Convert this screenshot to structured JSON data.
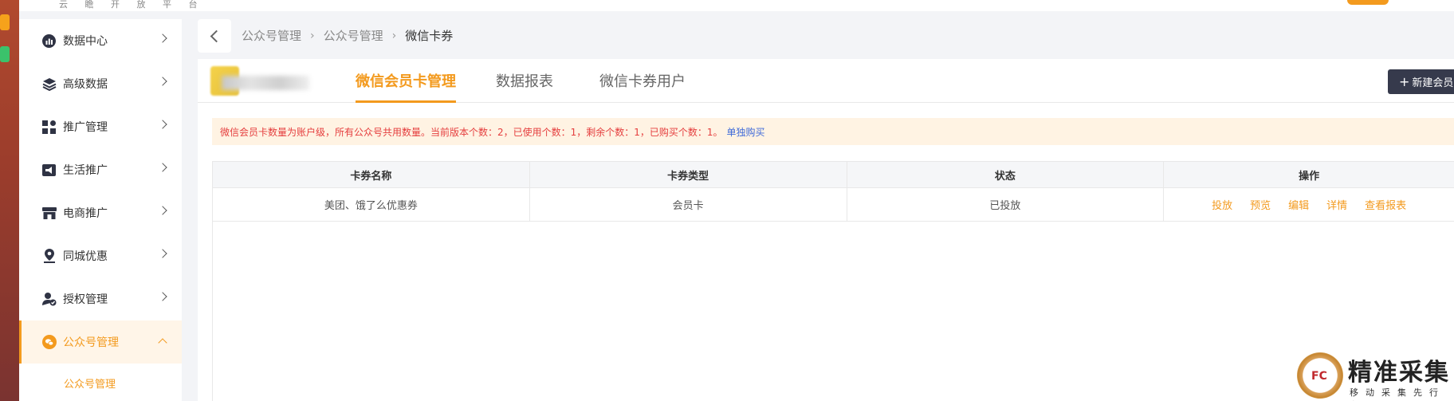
{
  "brand": {
    "subtitle": "云 瞻 开 放 平 台"
  },
  "colors": {
    "accent": "#f39a1e",
    "notice_text": "#e53e3e",
    "link": "#3f6ad8",
    "dark_button": "#363a4c"
  },
  "sidebar": {
    "items": [
      {
        "label": "数据中心",
        "icon": "chart-icon"
      },
      {
        "label": "高级数据",
        "icon": "layers-icon"
      },
      {
        "label": "推广管理",
        "icon": "grid-icon"
      },
      {
        "label": "生活推广",
        "icon": "megaphone-icon"
      },
      {
        "label": "电商推广",
        "icon": "shop-icon"
      },
      {
        "label": "同城优惠",
        "icon": "location-icon"
      },
      {
        "label": "授权管理",
        "icon": "user-check-icon"
      },
      {
        "label": "公众号管理",
        "icon": "wechat-icon",
        "active": true
      }
    ],
    "subitem": "公众号管理"
  },
  "breadcrumb": [
    "公众号管理",
    "公众号管理",
    "微信卡券"
  ],
  "tabs": [
    {
      "label": "微信会员卡管理",
      "active": true
    },
    {
      "label": "数据报表"
    },
    {
      "label": "微信卡券用户"
    }
  ],
  "new_button": "新建会员",
  "notice": {
    "text": "微信会员卡数量为账户级，所有公众号共用数量。当前版本个数：2，已使用个数：1，剩余个数：1，已购买个数：1。",
    "link": "单独购买"
  },
  "table": {
    "columns": [
      "卡券名称",
      "卡券类型",
      "状态",
      "操作"
    ],
    "rows": [
      {
        "name": "美团、饿了么优惠券",
        "type": "会员卡",
        "status": "已投放",
        "actions": [
          "投放",
          "预览",
          "编辑",
          "详情",
          "查看报表"
        ]
      }
    ]
  },
  "watermark": {
    "seal": "FC",
    "title": "精准采集",
    "subtitle": "移动采集先行者"
  }
}
